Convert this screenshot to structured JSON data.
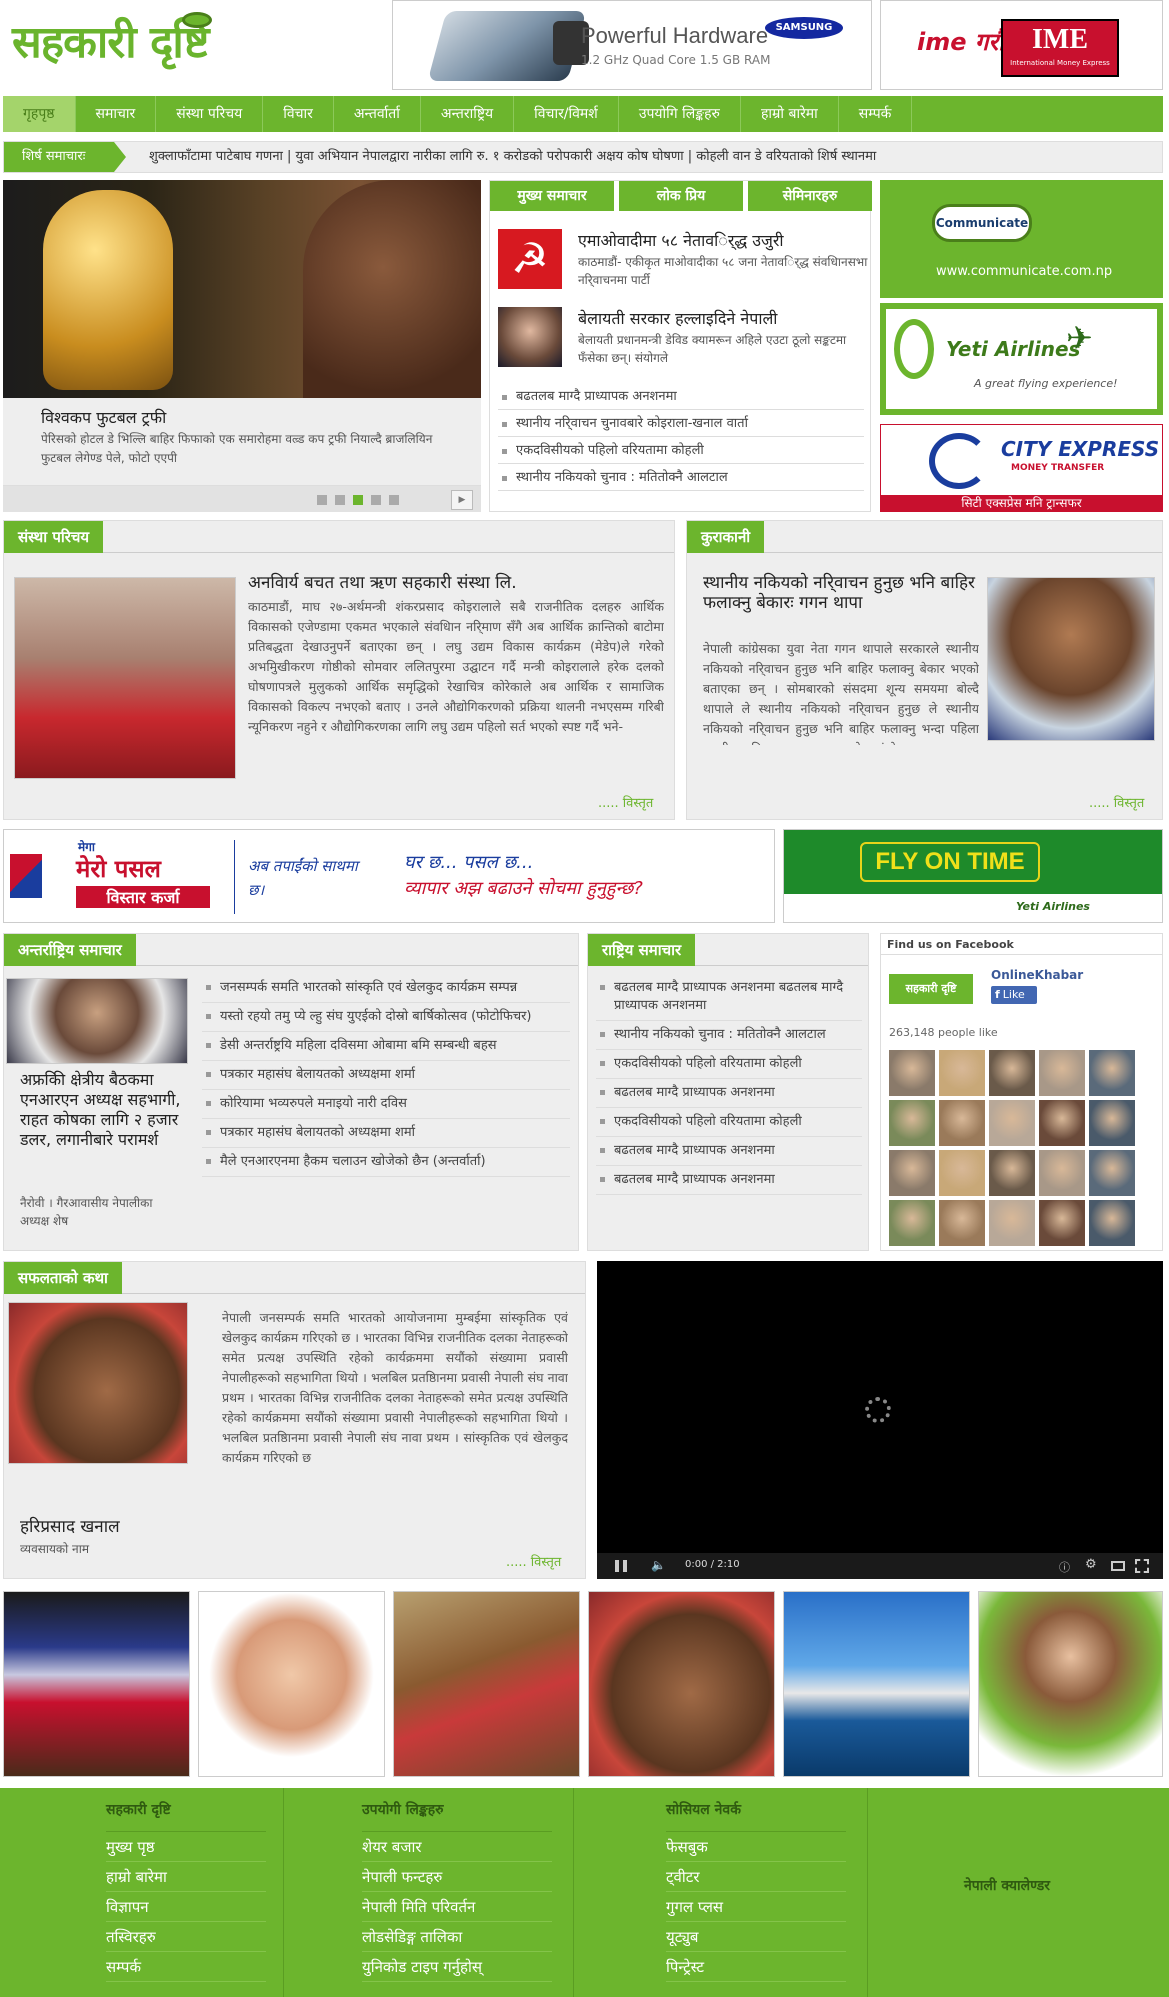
{
  "header": {
    "logo_text": "सहकारी दृष्टि",
    "ad_samsung": {
      "title": "Powerful Hardware",
      "sub": "1.2 GHz Quad Core 1.5 GB RAM",
      "brand": "SAMSUNG"
    },
    "ad_ime": {
      "left": "ime गरौ",
      "right": "IME",
      "sub": "International Money Express"
    }
  },
  "nav": [
    "गृहपृष्ठ",
    "समाचार",
    "संस्था परिचय",
    "विचार",
    "अन्तर्वार्ता",
    "अन्तराष्ट्रिय",
    "विचार/विमर्श",
    "उपयोगि लिङ्कहरु",
    "हाम्रो बारेमा",
    "सम्पर्क"
  ],
  "ticker": {
    "label": "शिर्ष समाचारः",
    "text": "शुक्लाफाँटामा पाटेबाघ गणना | युवा अभियान नेपालद्वारा नारीका लागि रु. १ करोडको परोपकारी अक्षय कोष घोषणा | कोहली वान डे वरियताको शिर्ष स्थानमा"
  },
  "slider": {
    "title": "विश्वकप फुटबल ट्रफी",
    "desc": "पेरिसको होटल डे भिल्लि बाहिर फिफाको एक समारोहमा वल्र्ड कप ट्रफी नियाल्दै ब्राजलियिन फुटबल लेगेण्ड पेले, फोटो एएपी",
    "next_icon": "▶"
  },
  "news": {
    "tabs": [
      "मुख्य समाचार",
      "लोक प्रिय",
      "सेमिनारहरु"
    ],
    "stories": [
      {
        "title": "एमाओवादीमा ५८ नेतावर्िद्ध उजुरी",
        "desc": "काठमाडौं- एकीकृत माओवादीका ५८ जना नेतावर्िद्ध संवधिानसभा नरि्वाचनमा पार्टी"
      },
      {
        "title": "बेलायती सरकार हल्लाइदिने नेपाली",
        "desc": "बेलायती प्रधानमन्त्री डेविड क्यामरून अहिले एउटा ठूलो सङ्कटमा फँसेका छन्। संयोगले"
      }
    ],
    "list": [
      "बढतलब माग्दै प्राध्यापक अनशनमा",
      "स्थानीय नरि्वाचन चुनावबारे कोइराला-खनाल वार्ता",
      "एकदविसीयको पहिलो वरियतामा कोहली",
      "स्थानीय नकियको चुनाव : मतितोक्नै आलटाल"
    ]
  },
  "right_ads": {
    "communicate": {
      "bubble": "Communicate",
      "url": "www.communicate.com.np"
    },
    "yeti": {
      "name": "Yeti Airlines",
      "tag": "A great flying experience!"
    },
    "cityexpress": {
      "name": "CITY EXPRESS",
      "sub": "MONEY TRANSFER",
      "footer": "सिटी एक्सप्रेस मनि ट्रान्सफर"
    }
  },
  "sanstha": {
    "head": "संस्था परिचय",
    "title": "अनविार्य बचत तथा ऋण सहकारी संस्था लि.",
    "body": "काठमाडौं, माघ २७-अर्थमन्त्री शंकरप्रसाद कोइरालाले सबै राजनीतिक दलहरु आर्थिक विकासको एजेण्डामा एकमत भएकाले संवधिान नरि्माण सँगै अब आर्थिक क्रान्तिको बाटोमा प्रतिबद्धता देखाउनुपर्ने बताएका छन् । लघु उद्यम विकास कार्यक्रम (मेडेप)ले गरेको अभमिुखीकरण गोष्ठीको सोमवार ललितपुरमा उद्घाटन गर्दै मन्त्री कोइरालाले हरेक दलको घोषणापत्रले मुलुकको आर्थिक समृद्धिको रेखाचित्र कोरेकाले अब आर्थिक र सामाजिक विकासको विकल्प नभएको बताए । उनले औद्योगिकरणको प्रक्रिया थालनी नभएसम्म गरिबी न्यूनिकरण नहुने र औद्योगिकरणका लागि लघु उद्यम पहिलो सर्त भएको स्पष्ट गर्दै भने-",
    "more": "..... विस्तृत"
  },
  "kurakani": {
    "head": "कुराकानी",
    "title": "स्थानीय नकियको नरि्वाचन हुनुछ भनि बाहिर फलाक्नु बेकारः गगन थापा",
    "body": "नेपाली कांग्रेसका युवा नेता गगन थापाले सरकारले स्थानीय नकियको नरि्वाचन हुनुछ भनि बाहिर फलाक्नु बेकार भएको बताएका छन् । सोमबारको संसदमा शून्य समयमा बोल्दै थापाले ले स्थानीय नकियको नरि्वाचन हुनुछ ले स्थानीय नकियको नरि्वाचन हुनुछ भनि बाहिर फलाक्नु भन्दा पहिला स्थानीय नकिय स्वायत्त शासन ऐन संशोधन गरन सदनमा तत्काल वधियेक",
    "more": "..... विस्तृत"
  },
  "banner_mero": {
    "top": "मेगा",
    "brand": "मेरो पसल",
    "sub": "विस्तार कर्जा",
    "tag1": "अब तपाईंको साथमा छ।",
    "tag2a": "घर छ... पसल छ...",
    "tag2b": "व्यापार अझ बढाउने सोचमा हुनुहुन्छ?"
  },
  "banner_fly": {
    "text": "FLY ON TIME",
    "brand": "Yeti Airlines"
  },
  "intl": {
    "head": "अन्तर्राष्ट्रिय समाचार",
    "feature_title": "अफ्रकिी क्षेत्रीय बैठकमा एनआरएन अध्यक्ष सहभागी, राहत कोषका लागि २ हजार डलर, लगानीबारे परामर्श",
    "feature_sub": "नैरोवी । गैरआवासीय नेपालीका अध्यक्ष शेष",
    "list": [
      "जनसम्पर्क समति भारतको सांस्कृति एवं खेलकुद कार्यक्रम सम्पन्न",
      "यस्तो रहयो तमु प्ये ल्हु संघ युएईको दोस्रो बार्षिकोत्सव (फोटोफिचर)",
      "डेसी अन्तर्राष्ट्रयि महिला दविसमा ओबामा बमि सम्बन्धी बहस",
      "पत्रकार महासंघ बेलायतको अध्यक्षमा शर्मा",
      "कोरियामा भव्यरुपले मनाइयो नारी दविस",
      "पत्रकार महासंघ बेलायतको अध्यक्षमा शर्मा",
      "मैले एनआरएनमा हैकम चलाउन खोजेको छैन (अन्तर्वार्ता)"
    ]
  },
  "national": {
    "head": "राष्ट्रिय समाचार",
    "list": [
      "बढतलब माग्दै प्राध्यापक अनशनमा बढतलब माग्दै प्राध्यापक अनशनमा",
      "स्थानीय नकियको चुनाव : मतितोक्नै आलटाल",
      "एकदविसीयको पहिलो वरियतामा कोहली",
      "बढतलब माग्दै प्राध्यापक अनशनमा",
      "एकदविसीयको पहिलो वरियतामा कोहली",
      "बढतलब माग्दै प्राध्यापक अनशनमा",
      "बढतलब माग्दै प्राध्यापक अनशनमा"
    ]
  },
  "facebook": {
    "head": "Find us on Facebook",
    "page": "OnlineKhabar",
    "like": "Like",
    "count": "263,148 people like"
  },
  "success": {
    "head": "सफलताको कथा",
    "name": "हरिप्रसाद खनाल",
    "role": "व्यवसायको नाम",
    "body": "नेपाली जनसम्पर्क समति भारतको आयोजनामा मुम्बईमा सांस्कृतिक एवं खेलकुद कार्यक्रम गरिएको छ । भारतका विभिन्न राजनीतिक दलका नेताहरूको समेत प्रत्यक्ष उपस्थिति रहेको कार्यक्रममा सयौंको संख्यामा प्रवासी नेपालीहरूको सहभागिता थियो । भलबिल प्रतष्ठिानमा प्रवासी नेपाली संघ नावा प्रथम । भारतका विभिन्न राजनीतिक दलका नेताहरूको समेत प्रत्यक्ष उपस्थिति रहेको कार्यक्रममा सयौंको संख्यामा प्रवासी नेपालीहरूको सहभागिता थियो । भलबिल प्रतष्ठिानमा प्रवासी नेपाली संघ नावा प्रथम । सांस्कृतिक एवं खेलकुद कार्यक्रम गरिएको छ",
    "more": "..... विस्तृत"
  },
  "video": {
    "time": "0:00 / 2:10"
  },
  "footer": {
    "cols": [
      {
        "head": "सहकारी दृष्टि",
        "items": [
          "मुख्य पृष्ठ",
          "हाम्रो बारेमा",
          "विज्ञापन",
          "तस्विरहरु",
          "सम्पर्क"
        ]
      },
      {
        "head": "उपयोगी लिङ्कहरु",
        "items": [
          "शेयर बजार",
          "नेपाली फन्टहरु",
          "नेपाली मिति परिवर्तन",
          "लोडसेडिङ्ग तालिका",
          "युनिकोड टाइप गर्नुहोस्"
        ]
      },
      {
        "head": "सोसियल नेवर्क",
        "items": [
          "फेसबुक",
          "ट्वीटर",
          "गुगल प्लस",
          "यूट्युब",
          "पिन्ट्रेस्ट"
        ]
      }
    ],
    "calendar": "नेपाली क्यालेण्डर"
  },
  "colors": {
    "brand_green": "#6cb52d",
    "dark_green": "#4a7f1a",
    "red": "#c8102e"
  }
}
